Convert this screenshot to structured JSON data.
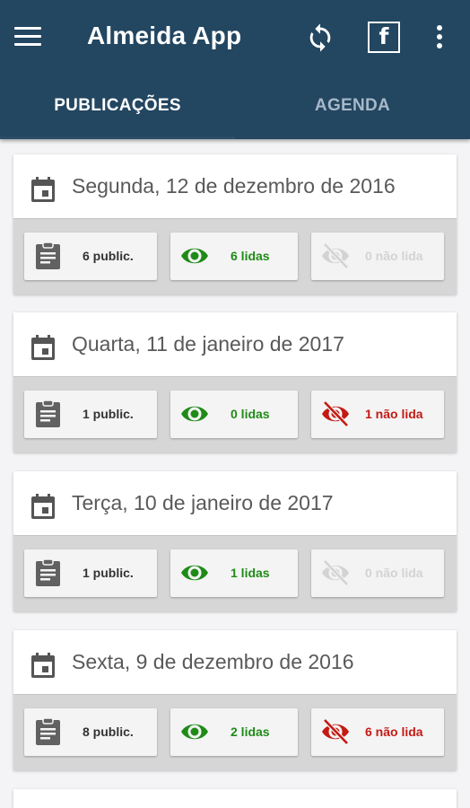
{
  "app": {
    "title": "Almeida App",
    "icons": [
      "menu-icon",
      "refresh-icon",
      "facebook-icon",
      "more-vertical-icon"
    ],
    "facebook_glyph": "f"
  },
  "tabs": [
    {
      "label": "PUBLICAÇÕES",
      "active": true
    },
    {
      "label": "AGENDA",
      "active": false
    }
  ],
  "colors": {
    "appbar": "#234661",
    "read": "#1f8b17",
    "unread": "#c41a14",
    "disabled": "#d3d3d3",
    "date_text": "#595959"
  },
  "cards": [
    {
      "date": "Segunda, 12 de dezembro de 2016",
      "publications": "6 public.",
      "read": "6 lidas",
      "unread": "0 não lida",
      "unread_active": false
    },
    {
      "date": "Quarta, 11 de janeiro de 2017",
      "publications": "1 public.",
      "read": "0 lidas",
      "unread": "1 não lida",
      "unread_active": true
    },
    {
      "date": "Terça, 10 de janeiro de 2017",
      "publications": "1 public.",
      "read": "1 lidas",
      "unread": "0 não lida",
      "unread_active": false
    },
    {
      "date": "Sexta, 9 de dezembro de 2016",
      "publications": "8 public.",
      "read": "2 lidas",
      "unread": "6 não lida",
      "unread_active": true
    }
  ]
}
